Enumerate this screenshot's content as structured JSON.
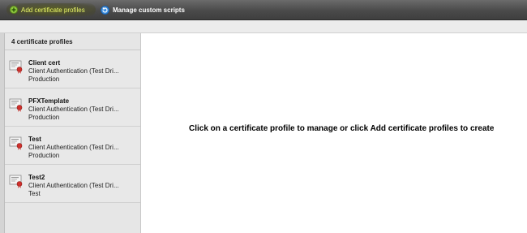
{
  "toolbar": {
    "add_label": "Add certificate profiles",
    "scripts_label": "Manage custom scripts",
    "add_color": "#e8f56a"
  },
  "sidebar": {
    "header": "4 certificate profiles",
    "items": [
      {
        "name": "Client cert",
        "type": "Client Authentication (Test Dri...",
        "env": "Production"
      },
      {
        "name": "PFXTemplate",
        "type": "Client Authentication (Test Dri...",
        "env": "Production"
      },
      {
        "name": "Test",
        "type": "Client Authentication (Test Dri...",
        "env": "Production"
      },
      {
        "name": "Test2",
        "type": "Client Authentication (Test Dri...",
        "env": "Test"
      }
    ]
  },
  "main": {
    "message": "Click on a certificate profile to manage or click Add certificate profiles to create"
  },
  "icons": {
    "add": "plus-circle-icon",
    "scripts": "refresh-icon",
    "profile": "certificate-icon"
  }
}
